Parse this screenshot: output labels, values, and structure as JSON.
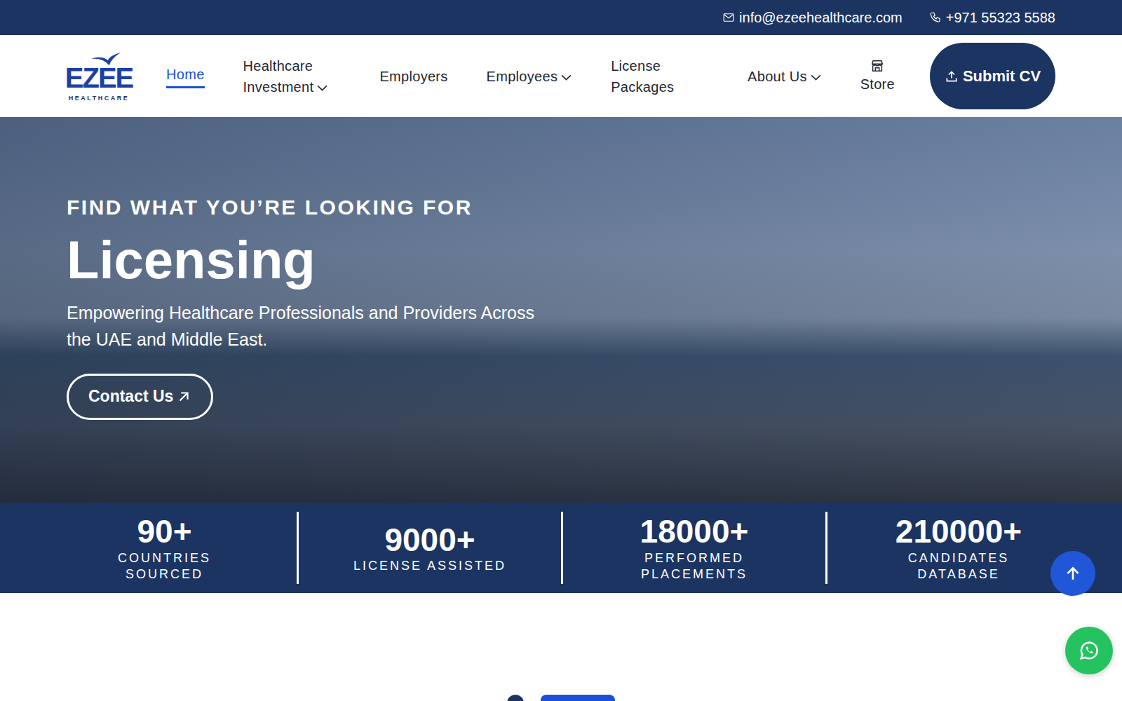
{
  "topbar": {
    "email": "info@ezeehealthcare.com",
    "phone": "+971 55323 5588"
  },
  "logo": {
    "name": "EZEE",
    "tagline": "HEALTHCARE"
  },
  "nav": [
    {
      "label": "Home",
      "selected": true,
      "dropdown": false,
      "kind": "text"
    },
    {
      "label": "Healthcare Investment",
      "selected": false,
      "dropdown": true,
      "kind": "text"
    },
    {
      "label": "Employers",
      "selected": false,
      "dropdown": false,
      "kind": "text"
    },
    {
      "label": "Employees",
      "selected": false,
      "dropdown": true,
      "kind": "text"
    },
    {
      "label": "License Packages",
      "selected": false,
      "dropdown": false,
      "kind": "text"
    },
    {
      "label": "About Us",
      "selected": false,
      "dropdown": true,
      "kind": "text"
    },
    {
      "label": "Store",
      "selected": false,
      "dropdown": false,
      "kind": "icon"
    }
  ],
  "cta": {
    "label": "Submit CV"
  },
  "hero": {
    "eyebrow": "FIND WHAT YOU’RE LOOKING FOR",
    "title": "Licensing",
    "subtitle": "Empowering Healthcare Professionals and Providers Across the UAE and Middle East.",
    "button": "Contact Us"
  },
  "stats": [
    {
      "value": "90+",
      "label": "COUNTRIES SOURCED"
    },
    {
      "value": "9000+",
      "label": "LICENSE ASSISTED"
    },
    {
      "value": "18000+",
      "label": "PERFORMED PLACEMENTS"
    },
    {
      "value": "210000+",
      "label": "CANDIDATES DATABASE"
    }
  ],
  "carousel": [
    {
      "selected": false
    },
    {
      "selected": true
    }
  ]
}
